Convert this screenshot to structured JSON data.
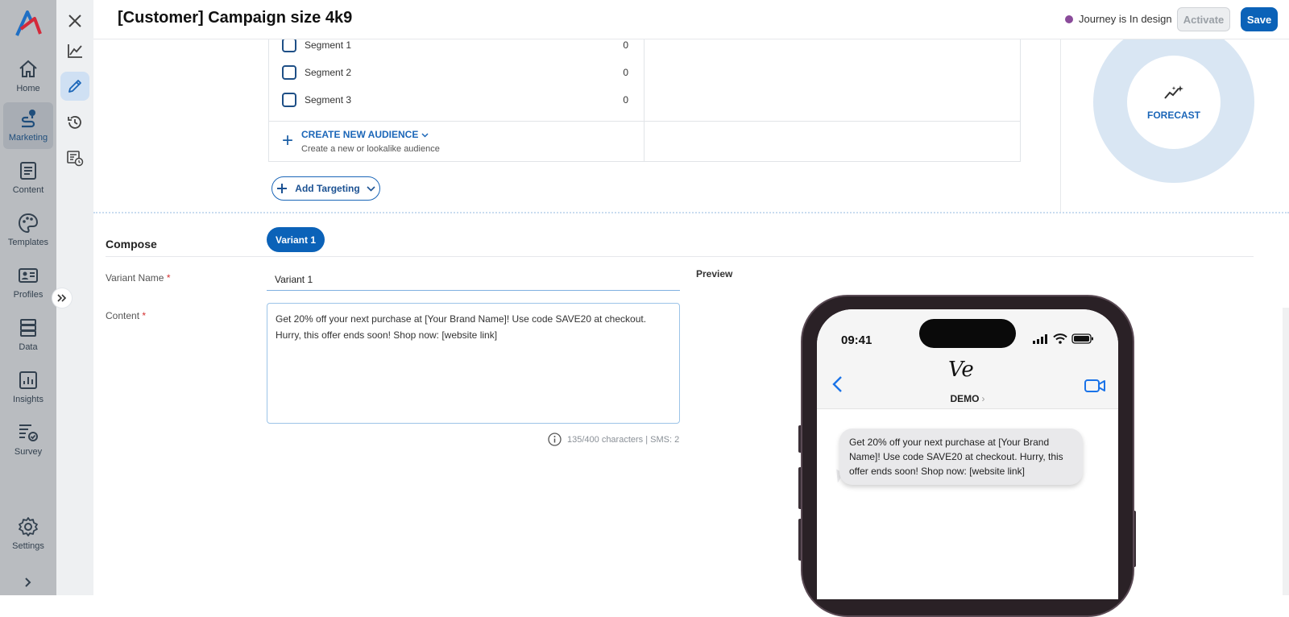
{
  "nav": {
    "items": [
      {
        "label": "Home",
        "icon": "home-icon"
      },
      {
        "label": "Marketing",
        "icon": "marketing-icon"
      },
      {
        "label": "Content",
        "icon": "content-icon"
      },
      {
        "label": "Templates",
        "icon": "palette-icon"
      },
      {
        "label": "Profiles",
        "icon": "profile-card-icon"
      },
      {
        "label": "Data",
        "icon": "database-icon"
      },
      {
        "label": "Insights",
        "icon": "insights-icon"
      },
      {
        "label": "Survey",
        "icon": "survey-icon"
      },
      {
        "label": "Settings",
        "icon": "gear-icon"
      }
    ],
    "active": "Marketing"
  },
  "header": {
    "title": "[Customer] Campaign size 4k9",
    "status": "Journey is In design",
    "status_color": "#8a4b9a",
    "activate_label": "Activate",
    "save_label": "Save"
  },
  "audience": {
    "segments": [
      {
        "label": "Segment 1",
        "count": "0"
      },
      {
        "label": "Segment 2",
        "count": "0"
      },
      {
        "label": "Segment 3",
        "count": "0"
      }
    ],
    "create_label": "CREATE NEW AUDIENCE",
    "create_sub": "Create a new or lookalike audience",
    "add_targeting": "Add Targeting"
  },
  "forecast": {
    "label": "FORECAST"
  },
  "compose": {
    "title": "Compose",
    "variant_tab": "Variant 1",
    "variant_name_label": "Variant Name",
    "variant_name_value": "Variant 1",
    "content_label": "Content",
    "content_value": "Get 20% off your next purchase at [Your Brand Name]! Use code SAVE20 at checkout. Hurry, this offer ends soon! Shop now: [website link]",
    "char_count": "135/400 characters | SMS: 2",
    "required_mark": "*"
  },
  "preview": {
    "label": "Preview",
    "time": "09:41",
    "contact_logo": "Ve",
    "contact_name": "DEMO",
    "message": "Get 20% off your next purchase at [Your Brand Name]! Use code SAVE20 at checkout. Hurry, this offer ends soon! Shop now: [website link]"
  },
  "colors": {
    "accent": "#0b62b8",
    "nav_bg": "#b9bcc0",
    "rail_bg": "#eef0f2",
    "forecast_ring": "#d9e6f3"
  }
}
